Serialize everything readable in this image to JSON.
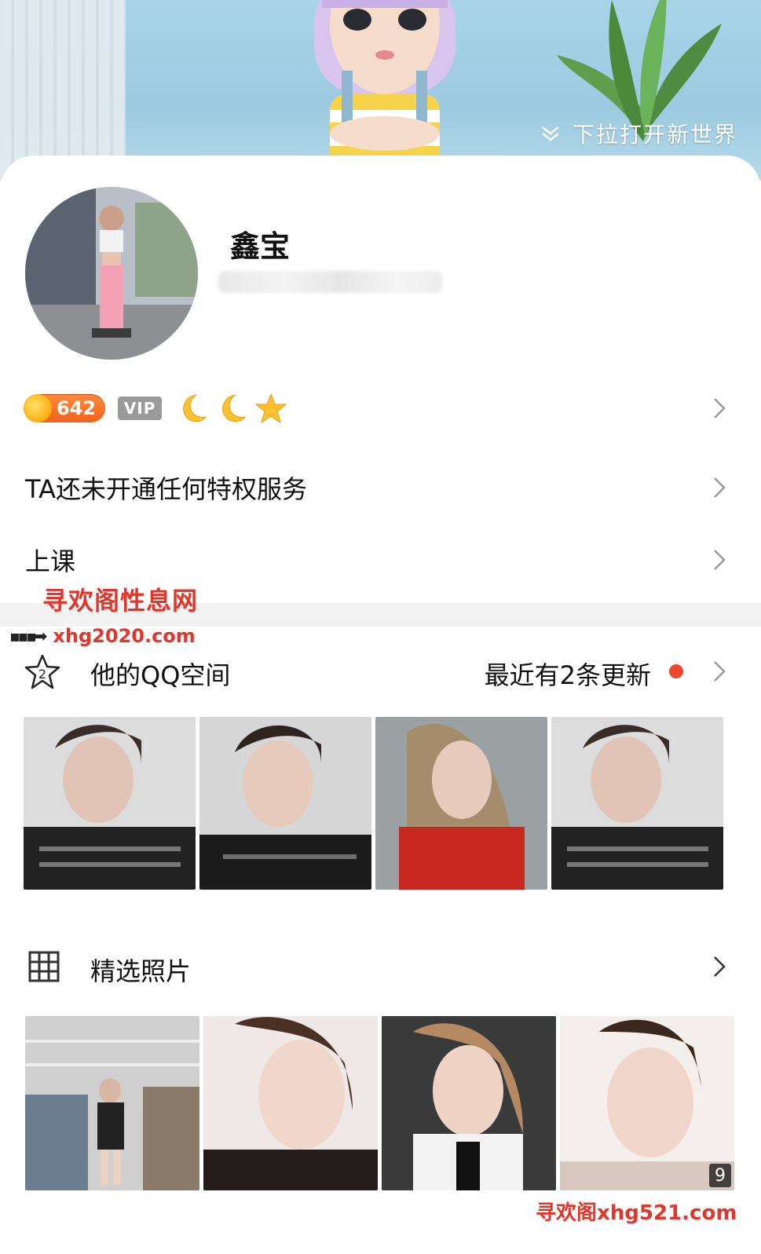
{
  "header": {
    "pull_hint": "下拉打开新世界"
  },
  "profile": {
    "name": "鑫宝",
    "level_coins": "642",
    "vip_label": "VIP"
  },
  "rows": {
    "privilege": "TA还未开通任何特权服务",
    "status": "上课"
  },
  "watermarks": {
    "top": "寻欢阁性息网",
    "url": "xhg2020.com",
    "bottom": "寻欢阁xhg521.com"
  },
  "qzone": {
    "title": "他的QQ空间",
    "update_text": "最近有2条更新",
    "icon_glyph": "2"
  },
  "featured": {
    "title": "精选照片",
    "more_count": "9"
  },
  "colors": {
    "accent_red": "#f0472f",
    "coin_orange": "#f0621e",
    "watermark_red": "#e4352a"
  },
  "icons": [
    "chevron-down-icon",
    "chevron-right-icon",
    "moon-icon",
    "star-icon",
    "qzone-star-icon",
    "grid-icon"
  ]
}
